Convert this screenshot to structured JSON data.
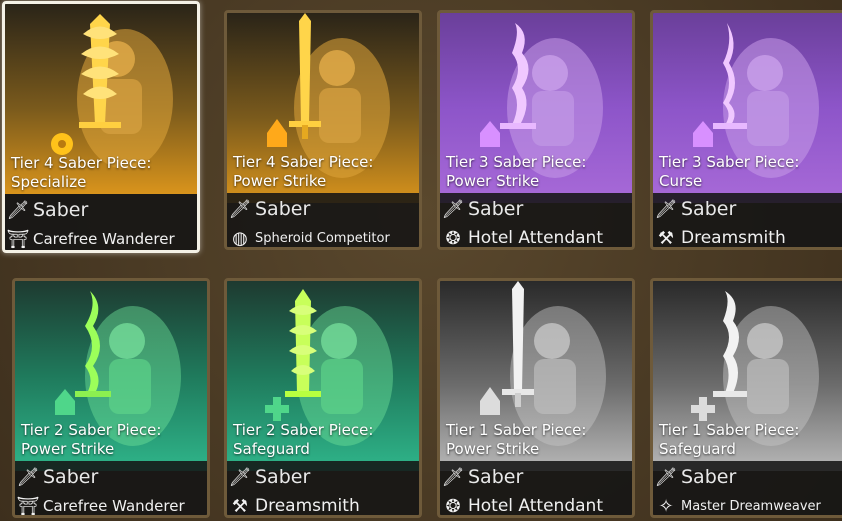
{
  "cards": [
    {
      "title_line1": "Tier 4 Saber Piece:",
      "title_line2": "Specialize",
      "weapon": "Saber",
      "character": "Carefree Wanderer",
      "tier_color": "#d9941c",
      "char_icon": "wanderer-icon",
      "selected": true
    },
    {
      "title_line1": "Tier 4 Saber Piece:",
      "title_line2": "Power Strike",
      "weapon": "Saber",
      "character": "Spheroid Competitor",
      "tier_color": "#d9941c",
      "char_icon": "spheroid-icon",
      "selected": false
    },
    {
      "title_line1": "Tier 3 Saber Piece:",
      "title_line2": "Power Strike",
      "weapon": "Saber",
      "character": "Hotel Attendant",
      "tier_color": "#9a5ad6",
      "char_icon": "attendant-icon",
      "selected": false
    },
    {
      "title_line1": "Tier 3 Saber Piece:",
      "title_line2": "Curse",
      "weapon": "Saber",
      "character": "Dreamsmith",
      "tier_color": "#9a5ad6",
      "char_icon": "dreamsmith-icon",
      "selected": false
    },
    {
      "title_line1": "Tier 2 Saber Piece:",
      "title_line2": "Power Strike",
      "weapon": "Saber",
      "character": "Carefree Wanderer",
      "tier_color": "#2fb58a",
      "char_icon": "wanderer-icon",
      "selected": false
    },
    {
      "title_line1": "Tier 2 Saber Piece:",
      "title_line2": "Safeguard",
      "weapon": "Saber",
      "character": "Dreamsmith",
      "tier_color": "#2fb58a",
      "char_icon": "dreamsmith-icon",
      "selected": false
    },
    {
      "title_line1": "Tier 1 Saber Piece:",
      "title_line2": "Power Strike",
      "weapon": "Saber",
      "character": "Hotel Attendant",
      "tier_color": "#b8b8b8",
      "char_icon": "attendant-icon",
      "selected": false
    },
    {
      "title_line1": "Tier 1 Saber Piece:",
      "title_line2": "Safeguard",
      "weapon": "Saber",
      "character": "Master Dreamweaver",
      "tier_color": "#b8b8b8",
      "char_icon": "dreamweaver-icon",
      "selected": false
    }
  ]
}
